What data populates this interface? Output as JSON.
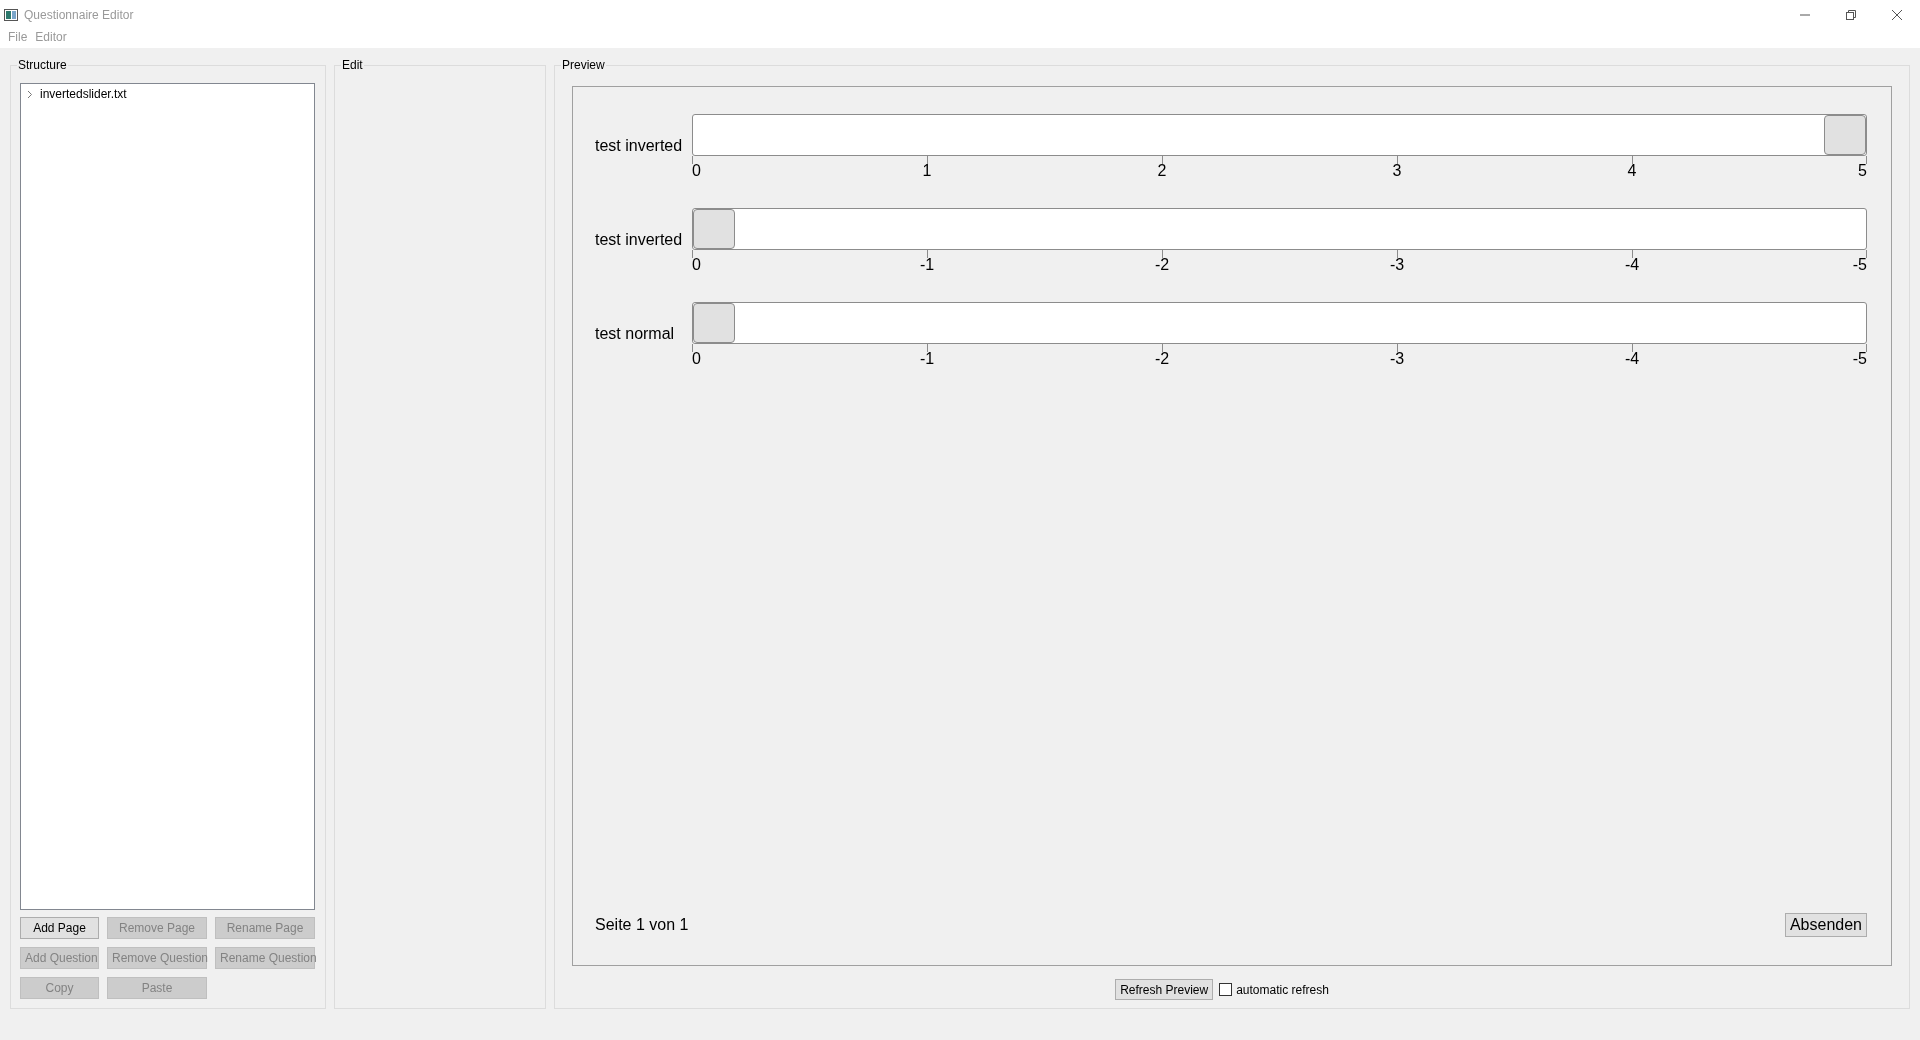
{
  "window": {
    "title": "Questionnaire Editor"
  },
  "menu": [
    "File",
    "Editor"
  ],
  "structure": {
    "title": "Structure",
    "tree": [
      {
        "label": "invertedslider.txt",
        "expanded": false
      }
    ],
    "buttons": [
      {
        "label": "Add Page",
        "disabled": false
      },
      {
        "label": "Remove Page",
        "disabled": true
      },
      {
        "label": "Rename Page",
        "disabled": true
      },
      {
        "label": "Add Question",
        "disabled": true
      },
      {
        "label": "Remove Question",
        "disabled": true
      },
      {
        "label": "Rename Question",
        "disabled": true
      },
      {
        "label": "Copy",
        "disabled": true
      },
      {
        "label": "Paste",
        "disabled": true
      }
    ]
  },
  "edit": {
    "title": "Edit"
  },
  "preview": {
    "title": "Preview",
    "sliders": [
      {
        "label": "test inverted",
        "level": 1,
        "ticks": [
          "0",
          "1",
          "2",
          "3",
          "4",
          "5"
        ]
      },
      {
        "label": "test inverted",
        "level": 0,
        "ticks": [
          "0",
          "-1",
          "-2",
          "-3",
          "-4",
          "-5"
        ]
      },
      {
        "label": "test normal",
        "level": 0,
        "ticks": [
          "0",
          "-1",
          "-2",
          "-3",
          "-4",
          "-5"
        ]
      }
    ],
    "page_info": "Seite 1 von 1",
    "submit": "Absenden",
    "refresh_button": "Refresh Preview",
    "auto_refresh": {
      "label": "automatic refresh",
      "checked": false
    }
  }
}
